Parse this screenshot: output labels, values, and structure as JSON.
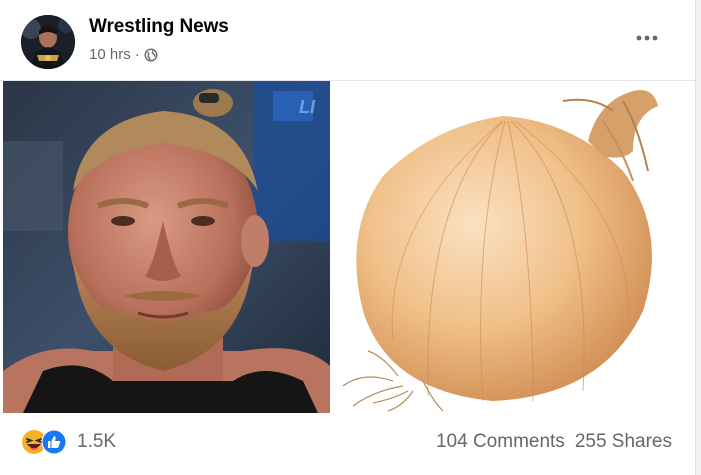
{
  "post": {
    "page_name": "Wrestling News",
    "time": "10 hrs",
    "privacy_icon": "globe-icon",
    "more_icon": "more-options-icon"
  },
  "images": {
    "left": "wrestler-photo",
    "right": "onion-photo"
  },
  "footer": {
    "reaction_icons": [
      "haha-reaction-icon",
      "like-reaction-icon"
    ],
    "reactions_count": "1.5K",
    "comments": "104 Comments",
    "shares": "255 Shares"
  },
  "colors": {
    "like_blue": "#1877f2",
    "haha_yellow": "#f7b125",
    "secondary_text": "#65676b"
  }
}
